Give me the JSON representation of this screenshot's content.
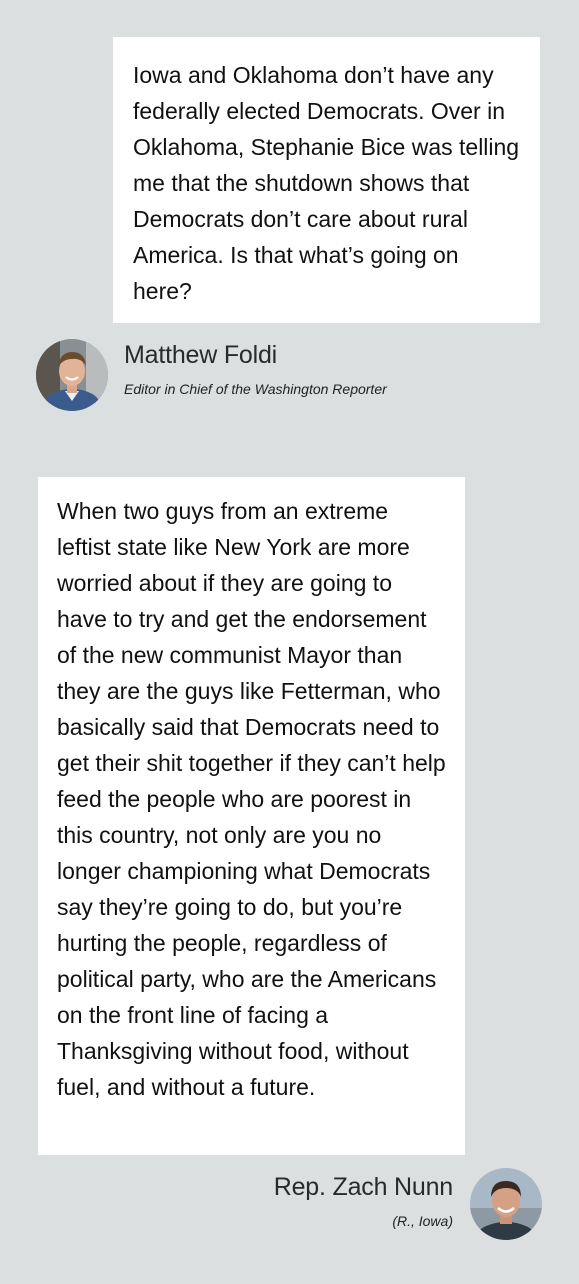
{
  "question": {
    "text": "Iowa and Oklahoma don’t have any federally elected Democrats. Over in Oklahoma, Stephanie Bice was telling me that the shutdown shows that Democrats don’t care about rural America. Is that what’s going on here?"
  },
  "interviewer": {
    "name": "Matthew Foldi",
    "title": "Editor in Chief of the Washington Reporter",
    "avatar_icon": "person-avatar-icon"
  },
  "answer": {
    "text": "When two guys from an extreme leftist state like New York are more worried about if they are going to have to try and get the endorsement of the new communist Mayor than they are the guys like Fetterman, who basically said that Democrats need to get their shit together if they can’t help feed the people who are poorest in this country, not only are you no longer championing what Democrats say they’re going to do, but you’re hurting the people, regardless of political party, who are the Americans on the front line of facing a Thanksgiving without food, without fuel, and without a future."
  },
  "respondent": {
    "name": "Rep. Zach Nunn",
    "title": "(R., Iowa)",
    "avatar_icon": "person-avatar-icon"
  },
  "colors": {
    "background": "#dcdfe0",
    "bubble": "#ffffff"
  }
}
